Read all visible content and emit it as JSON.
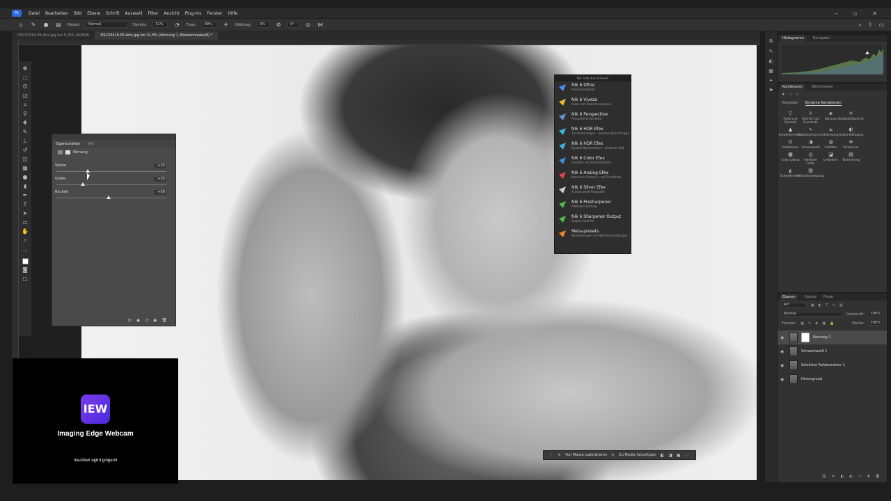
{
  "menu": [
    "Datei",
    "Bearbeiten",
    "Bild",
    "Ebene",
    "Schrift",
    "Auswahl",
    "Filter",
    "Ansicht",
    "Plug-ins",
    "Fenster",
    "Hilfe"
  ],
  "options": {
    "mode_label": "Modus:",
    "mode_value": "Normal",
    "opacity_label": "Deckkr.:",
    "opacity_value": "51%",
    "flow_label": "Fluss:",
    "flow_value": "99%",
    "smooth_label": "Glättung:",
    "smooth_value": "0%",
    "angle_value": "0°"
  },
  "tabs": [
    "DSC03416-PR-Arts.jpg bei 5,29% (RGB/8)",
    "DSC03419-PR-Arts.jpg bei 31,8% (Körnung 1, Ebenenmaske/8) *"
  ],
  "properties": {
    "tab1": "Eigenschaften",
    "tab2": "Info",
    "sub_label": "Körnung",
    "sliders": [
      {
        "name": "Stärke",
        "value": "+25",
        "pos": 0.3
      },
      {
        "name": "Größe",
        "value": "+25",
        "pos": 0.25
      },
      {
        "name": "Rauheit",
        "value": "+50",
        "pos": 0.5
      }
    ]
  },
  "webcam": {
    "logo": "IEW",
    "name": "Imaging Edge Webcam",
    "mirrored": "Imaging Edge Webcam"
  },
  "nik": {
    "header": "Nik Collection 6 Panels",
    "items": [
      {
        "title": "Nik 6 Dfine",
        "sub": "Rauschreduktion",
        "color": "#4a8ee6"
      },
      {
        "title": "Nik 6 Viveza",
        "sub": "Farbe und Tonwert anpassen",
        "color": "#e8b634"
      },
      {
        "title": "Nik 6 Perspective",
        "sub": "Perspektivenkorrektur",
        "color": "#6a8fd6"
      },
      {
        "title": "Nik 6 HDR Efex",
        "sub": "Zusammenfügen – mehrere Belichtungen",
        "color": "#3fb4d4"
      },
      {
        "title": "Nik 6 HDR Efex",
        "sub": "Dynamikkompression – einzelnes Bild",
        "color": "#3fb4d4"
      },
      {
        "title": "Nik 6 Color Efex",
        "sub": "Farbfilter und Kreativeffekte",
        "color": "#3a8fd8"
      },
      {
        "title": "Nik 6 Analog Efex",
        "sub": "Klassische Kamera- und Filmeffekte",
        "color": "#e04848"
      },
      {
        "title": "Nik 6 Silver Efex",
        "sub": "Schwarzweiß-Fotografie",
        "color": "#cccccc"
      },
      {
        "title": "Nik 6 Presharpener",
        "sub": "RAW-Vorschärfung",
        "color": "#4fb84a"
      },
      {
        "title": "Nik 6 Sharpener Output",
        "sub": "Output Schärfen",
        "color": "#4fb84a"
      },
      {
        "title": "Meta-presets",
        "sub": "Bearbeitungen von Nik-Voreinstellungen",
        "color": "#e8892a"
      }
    ]
  },
  "contextbar": {
    "subtract": "Von Maske subtrahieren",
    "add": "Zu Maske hinzufügen"
  },
  "histogram_panel": {
    "tab1": "Histogramm",
    "tab2": "Navigator"
  },
  "adjustments": {
    "tab1": "Korrekturen",
    "tab2": "Bibliotheken",
    "sub1": "Vorgaben",
    "sub2": "Einzelne Korrekturen",
    "items": [
      "Farbe und Dynamik",
      "Klarheit und Dunstentf.",
      "Körnung",
      "Helligkeit/Kontrast",
      "Tonwertkorrektur",
      "Gradationskurven",
      "Belichtung",
      "Farbton/Sättigung",
      "Farbbalance",
      "Schwarzweiß",
      "Fotofilter",
      "Kanalmixer",
      "Color Lookup",
      "Selektive Farbe",
      "Umkehren",
      "Tontrennung",
      "Schwellenwert",
      "Verlaufsumsetzung"
    ]
  },
  "layers": {
    "tab1": "Ebenen",
    "tab2": "Kanäle",
    "tab3": "Pfade",
    "search": "Art",
    "blend": "Normal",
    "opacity_label": "Deckkraft:",
    "opacity_value": "100%",
    "lock_label": "Fixieren:",
    "fill_label": "Fläche:",
    "fill_value": "100%",
    "items": [
      {
        "name": "Körnung 1",
        "mask": true
      },
      {
        "name": "Schwarzweiß 1",
        "mask": false
      },
      {
        "name": "Selektive Farbkorrektur 1",
        "mask": false
      },
      {
        "name": "Hintergrund",
        "mask": false
      }
    ]
  }
}
